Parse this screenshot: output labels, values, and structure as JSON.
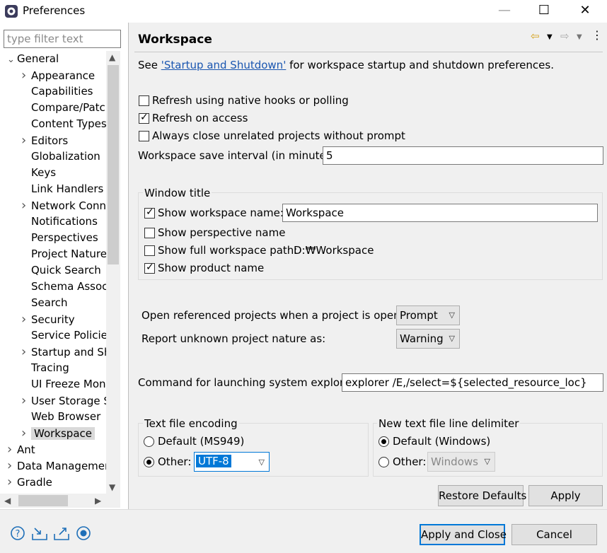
{
  "window": {
    "title": "Preferences",
    "minimize": "—",
    "maximize": "☐",
    "close": "✕"
  },
  "filter": {
    "placeholder": "type filter text"
  },
  "tree": {
    "items": [
      {
        "label": "General",
        "level": 0,
        "chevron": "v"
      },
      {
        "label": "Appearance",
        "level": 1,
        "chevron": ">"
      },
      {
        "label": "Capabilities",
        "level": 1,
        "chevron": ""
      },
      {
        "label": "Compare/Patch",
        "level": 1,
        "chevron": ""
      },
      {
        "label": "Content Types",
        "level": 1,
        "chevron": ""
      },
      {
        "label": "Editors",
        "level": 1,
        "chevron": ">"
      },
      {
        "label": "Globalization",
        "level": 1,
        "chevron": ""
      },
      {
        "label": "Keys",
        "level": 1,
        "chevron": ""
      },
      {
        "label": "Link Handlers",
        "level": 1,
        "chevron": ""
      },
      {
        "label": "Network Connections",
        "level": 1,
        "chevron": ">"
      },
      {
        "label": "Notifications",
        "level": 1,
        "chevron": ""
      },
      {
        "label": "Perspectives",
        "level": 1,
        "chevron": ""
      },
      {
        "label": "Project Natures",
        "level": 1,
        "chevron": ""
      },
      {
        "label": "Quick Search",
        "level": 1,
        "chevron": ""
      },
      {
        "label": "Schema Associations",
        "level": 1,
        "chevron": ""
      },
      {
        "label": "Search",
        "level": 1,
        "chevron": ""
      },
      {
        "label": "Security",
        "level": 1,
        "chevron": ">"
      },
      {
        "label": "Service Policies",
        "level": 1,
        "chevron": ""
      },
      {
        "label": "Startup and Shutdown",
        "level": 1,
        "chevron": ">"
      },
      {
        "label": "Tracing",
        "level": 1,
        "chevron": ""
      },
      {
        "label": "UI Freeze Monitoring",
        "level": 1,
        "chevron": ""
      },
      {
        "label": "User Storage Service",
        "level": 1,
        "chevron": ">"
      },
      {
        "label": "Web Browser",
        "level": 1,
        "chevron": ""
      },
      {
        "label": "Workspace",
        "level": 1,
        "chevron": ">",
        "selected": true
      },
      {
        "label": "Ant",
        "level": 0,
        "chevron": ">"
      },
      {
        "label": "Data Management",
        "level": 0,
        "chevron": ">"
      },
      {
        "label": "Gradle",
        "level": 0,
        "chevron": ">"
      }
    ]
  },
  "page": {
    "title": "Workspace",
    "intro_prefix": "See ",
    "intro_link": "'Startup and Shutdown'",
    "intro_suffix": " for workspace startup and shutdown preferences.",
    "refresh_native": {
      "label": "Refresh using native hooks or polling",
      "checked": false
    },
    "refresh_access": {
      "label": "Refresh on access",
      "checked": true
    },
    "always_close": {
      "label": "Always close unrelated projects without prompt",
      "checked": false
    },
    "save_interval": {
      "label": "Workspace save interval (in minutes):",
      "value": "5"
    },
    "window_title": {
      "legend": "Window title",
      "show_ws_name": {
        "label": "Show workspace name:",
        "checked": true,
        "value": "Workspace"
      },
      "show_perspective": {
        "label": "Show perspective name",
        "checked": false
      },
      "show_full_path": {
        "label": "Show full workspace path:",
        "checked": false,
        "path": "D:₩Workspace"
      },
      "show_product": {
        "label": "Show product name",
        "checked": true
      }
    },
    "open_referenced": {
      "label": "Open referenced projects when a project is opened:",
      "value": "Prompt"
    },
    "report_unknown": {
      "label": "Report unknown project nature as:",
      "value": "Warning"
    },
    "explorer_cmd": {
      "label": "Command for launching system explorer:",
      "value": "explorer /E,/select=${selected_resource_loc}"
    },
    "encoding": {
      "legend": "Text file encoding",
      "default_label": "Default (MS949)",
      "other_label": "Other:",
      "other_value": "UTF-8",
      "selected": "other"
    },
    "delimiter": {
      "legend": "New text file line delimiter",
      "default_label": "Default (Windows)",
      "other_label": "Other:",
      "other_value": "Windows",
      "selected": "default"
    },
    "restore_defaults": "Restore Defaults",
    "apply": "Apply"
  },
  "footer": {
    "apply_close": "Apply and Close",
    "cancel": "Cancel",
    "icons": [
      "help-icon",
      "import-icon",
      "export-icon",
      "record-icon"
    ]
  },
  "colors": {
    "accent": "#0078d7",
    "link": "#1a56b0"
  }
}
